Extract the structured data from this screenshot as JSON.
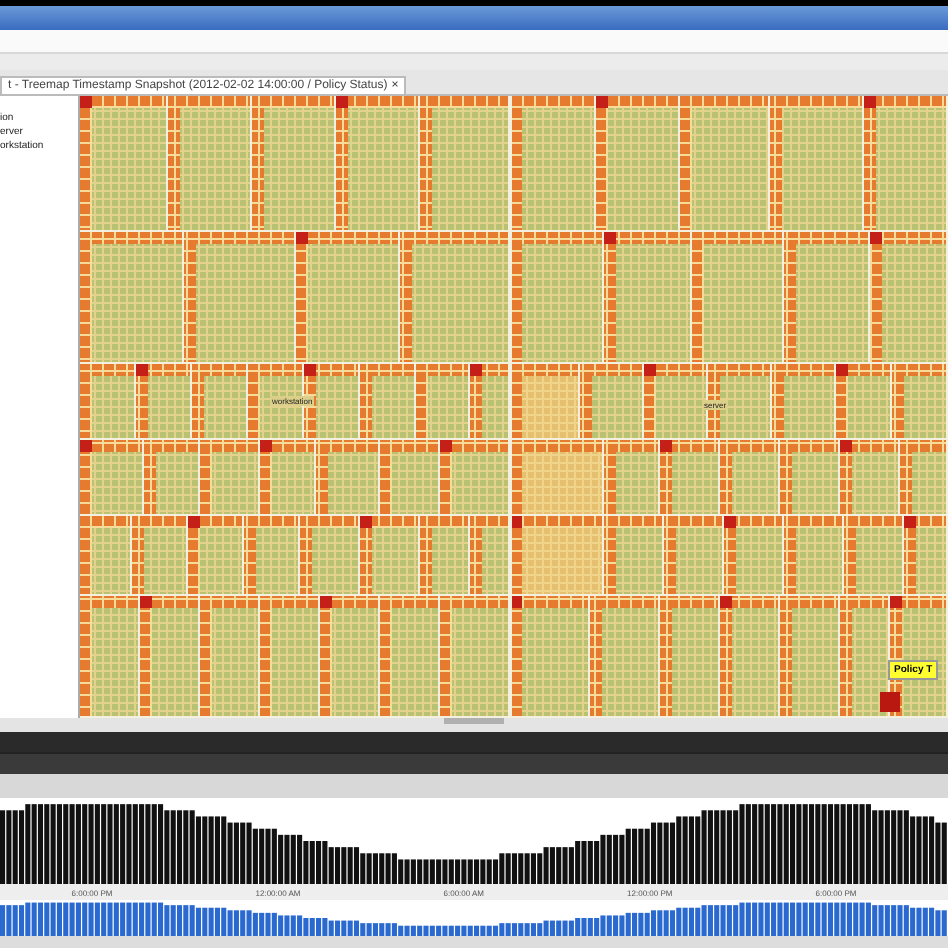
{
  "tab": {
    "label": "t - Treemap Timestamp Snapshot (2012-02-02 14:00:00 / Policy Status)",
    "close": "×"
  },
  "sidebar": {
    "items": [
      {
        "label": "ion",
        "selected": false
      },
      {
        "label": "erver",
        "selected": false
      },
      {
        "label": "orkstation",
        "selected": false
      }
    ]
  },
  "treemap": {
    "labels": [
      "workstation",
      "server"
    ],
    "tooltip": {
      "title": "Policy T"
    }
  },
  "timeline": {
    "time_labels": [
      "6:00:00 PM",
      "12:00:00 AM",
      "6:00:00 AM",
      "12:00:00 PM",
      "6:00:00 PM"
    ]
  }
}
